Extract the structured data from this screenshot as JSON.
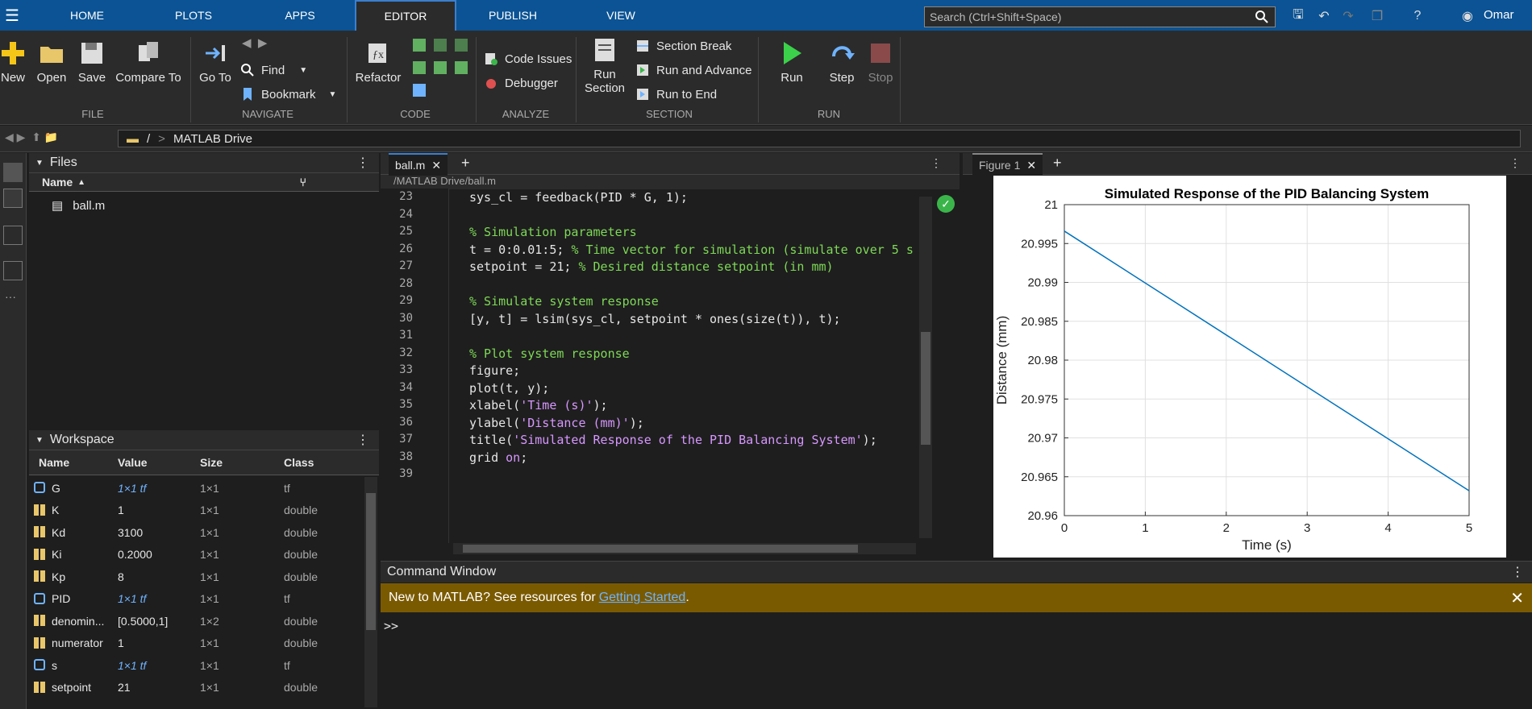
{
  "top_tabs": [
    "HOME",
    "PLOTS",
    "APPS",
    "EDITOR",
    "PUBLISH",
    "VIEW"
  ],
  "active_tab": "EDITOR",
  "search": {
    "placeholder": "Search (Ctrl+Shift+Space)"
  },
  "user": "Omar",
  "toolstrip": {
    "file": {
      "new": "New",
      "open": "Open",
      "save": "Save",
      "compare": "Compare To",
      "group": "FILE"
    },
    "navigate": {
      "goto": "Go To",
      "find": "Find",
      "bookmark": "Bookmark",
      "group": "NAVIGATE"
    },
    "code": {
      "refactor": "Refactor",
      "group": "CODE"
    },
    "analyze": {
      "code_issues": "Code Issues",
      "debugger": "Debugger",
      "group": "ANALYZE"
    },
    "section": {
      "run_section_1": "Run",
      "run_section_2": "Section",
      "section_break": "Section Break",
      "run_advance": "Run and Advance",
      "run_end": "Run to End",
      "group": "SECTION"
    },
    "run": {
      "run": "Run",
      "step": "Step",
      "stop": "Stop",
      "group": "RUN"
    }
  },
  "address": {
    "root": "/",
    "sep": ">",
    "folder": "MATLAB Drive"
  },
  "files": {
    "title": "Files",
    "col_name": "Name",
    "items": [
      "ball.m"
    ]
  },
  "workspace": {
    "title": "Workspace",
    "cols": {
      "name": "Name",
      "value": "Value",
      "size": "Size",
      "class": "Class"
    },
    "rows": [
      {
        "name": "G",
        "value": "1×1 tf",
        "size": "1×1",
        "class": "tf",
        "kind": "obj"
      },
      {
        "name": "K",
        "value": "1",
        "size": "1×1",
        "class": "double",
        "kind": "num"
      },
      {
        "name": "Kd",
        "value": "3100",
        "size": "1×1",
        "class": "double",
        "kind": "num"
      },
      {
        "name": "Ki",
        "value": "0.2000",
        "size": "1×1",
        "class": "double",
        "kind": "num"
      },
      {
        "name": "Kp",
        "value": "8",
        "size": "1×1",
        "class": "double",
        "kind": "num"
      },
      {
        "name": "PID",
        "value": "1×1 tf",
        "size": "1×1",
        "class": "tf",
        "kind": "obj"
      },
      {
        "name": "denomin...",
        "value": "[0.5000,1]",
        "size": "1×2",
        "class": "double",
        "kind": "num"
      },
      {
        "name": "numerator",
        "value": "1",
        "size": "1×1",
        "class": "double",
        "kind": "num"
      },
      {
        "name": "s",
        "value": "1×1 tf",
        "size": "1×1",
        "class": "tf",
        "kind": "obj"
      },
      {
        "name": "setpoint",
        "value": "21",
        "size": "1×1",
        "class": "double",
        "kind": "num"
      }
    ]
  },
  "editor": {
    "tab": "ball.m",
    "path": "/MATLAB Drive/ball.m",
    "lines": [
      {
        "n": "23",
        "segs": [
          {
            "t": "sys_cl = feedback(PID * G, 1);",
            "c": ""
          }
        ]
      },
      {
        "n": "24",
        "segs": []
      },
      {
        "n": "25",
        "segs": [
          {
            "t": "% Simulation parameters",
            "c": "cm"
          }
        ]
      },
      {
        "n": "26",
        "segs": [
          {
            "t": "t = 0:0.01:5; ",
            "c": ""
          },
          {
            "t": "% Time vector for simulation (simulate over 5 s",
            "c": "cm"
          }
        ]
      },
      {
        "n": "27",
        "segs": [
          {
            "t": "setpoint = 21; ",
            "c": ""
          },
          {
            "t": "% Desired distance setpoint (in mm)",
            "c": "cm"
          }
        ]
      },
      {
        "n": "28",
        "segs": []
      },
      {
        "n": "29",
        "segs": [
          {
            "t": "% Simulate system response",
            "c": "cm"
          }
        ]
      },
      {
        "n": "30",
        "segs": [
          {
            "t": "[y, t] = lsim(sys_cl, setpoint * ones(size(t)), t);",
            "c": ""
          }
        ]
      },
      {
        "n": "31",
        "segs": []
      },
      {
        "n": "32",
        "segs": [
          {
            "t": "% Plot system response",
            "c": "cm"
          }
        ]
      },
      {
        "n": "33",
        "segs": [
          {
            "t": "figure;",
            "c": ""
          }
        ]
      },
      {
        "n": "34",
        "segs": [
          {
            "t": "plot(t, y);",
            "c": ""
          }
        ]
      },
      {
        "n": "35",
        "segs": [
          {
            "t": "xlabel(",
            "c": ""
          },
          {
            "t": "'Time (s)'",
            "c": "str"
          },
          {
            "t": ");",
            "c": ""
          }
        ]
      },
      {
        "n": "36",
        "segs": [
          {
            "t": "ylabel(",
            "c": ""
          },
          {
            "t": "'Distance (mm)'",
            "c": "str"
          },
          {
            "t": ");",
            "c": ""
          }
        ]
      },
      {
        "n": "37",
        "segs": [
          {
            "t": "title(",
            "c": ""
          },
          {
            "t": "'Simulated Response of the PID Balancing System'",
            "c": "str"
          },
          {
            "t": ");",
            "c": ""
          }
        ]
      },
      {
        "n": "38",
        "segs": [
          {
            "t": "grid ",
            "c": ""
          },
          {
            "t": "on",
            "c": "str"
          },
          {
            "t": ";",
            "c": ""
          }
        ]
      },
      {
        "n": "39",
        "segs": []
      }
    ]
  },
  "figure": {
    "tab": "Figure 1"
  },
  "chart_data": {
    "type": "line",
    "title": "Simulated Response of the PID Balancing System",
    "xlabel": "Time (s)",
    "ylabel": "Distance (mm)",
    "xlim": [
      0,
      5
    ],
    "ylim": [
      20.96,
      21
    ],
    "xticks": [
      "0",
      "1",
      "2",
      "3",
      "4",
      "5"
    ],
    "yticks": [
      "20.96",
      "20.965",
      "20.97",
      "20.975",
      "20.98",
      "20.985",
      "20.99",
      "20.995",
      "21"
    ],
    "grid": true,
    "series": [
      {
        "x": [
          0,
          5
        ],
        "y": [
          20.9966,
          20.9632
        ]
      }
    ],
    "colors": {
      "line": "#0072bd"
    }
  },
  "command_window": {
    "title": "Command Window",
    "banner_text": "New to MATLAB? See resources for ",
    "banner_link": "Getting Started",
    "banner_end": ".",
    "prompt": ">>"
  }
}
